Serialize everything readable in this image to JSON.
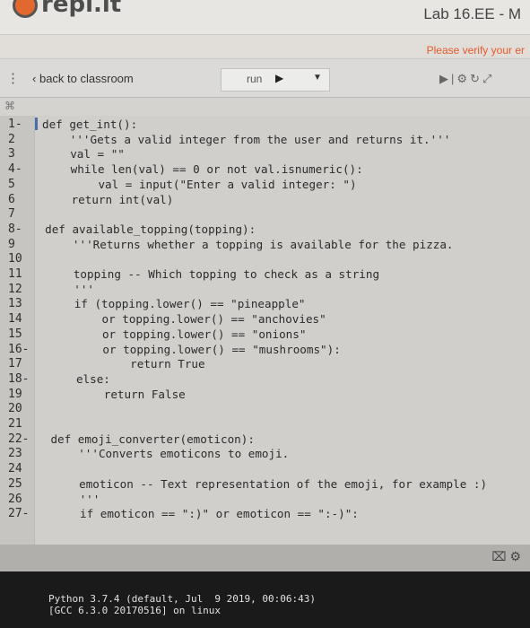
{
  "header": {
    "logo_text": "repl.it",
    "lab_title": "Lab 16.EE - M",
    "verify_notice": "Please verify your er"
  },
  "toolbar": {
    "menu_icon": "vertical-dots-icon",
    "back_label": "back to classroom",
    "run_label": "run",
    "run_icon": "play-icon",
    "dropdown_icon": "caret-down-icon",
    "right_icons": [
      "step-icon",
      "settings-icon",
      "reload-icon",
      "expand-icon"
    ]
  },
  "file_icon": "file-icon",
  "editor": {
    "lines": [
      {
        "n": "1",
        "fold": true,
        "text": "def get_int():"
      },
      {
        "n": "2",
        "fold": false,
        "text": "    '''Gets a valid integer from the user and returns it.'''"
      },
      {
        "n": "3",
        "fold": false,
        "text": "    val = \"\""
      },
      {
        "n": "4",
        "fold": true,
        "text": "    while len(val) == 0 or not val.isnumeric():"
      },
      {
        "n": "5",
        "fold": false,
        "text": "        val = input(\"Enter a valid integer: \")"
      },
      {
        "n": "6",
        "fold": false,
        "text": "    return int(val)"
      },
      {
        "n": "7",
        "fold": false,
        "text": ""
      },
      {
        "n": "8",
        "fold": true,
        "text": "def available_topping(topping):"
      },
      {
        "n": "9",
        "fold": false,
        "text": "    '''Returns whether a topping is available for the pizza."
      },
      {
        "n": "10",
        "fold": false,
        "text": ""
      },
      {
        "n": "11",
        "fold": false,
        "text": "    topping -- Which topping to check as a string"
      },
      {
        "n": "12",
        "fold": false,
        "text": "    '''"
      },
      {
        "n": "13",
        "fold": false,
        "text": "    if (topping.lower() == \"pineapple\""
      },
      {
        "n": "14",
        "fold": false,
        "text": "        or topping.lower() == \"anchovies\""
      },
      {
        "n": "15",
        "fold": false,
        "text": "        or topping.lower() == \"onions\""
      },
      {
        "n": "16",
        "fold": true,
        "text": "        or topping.lower() == \"mushrooms\"):"
      },
      {
        "n": "17",
        "fold": false,
        "text": "            return True"
      },
      {
        "n": "18",
        "fold": true,
        "text": "    else:"
      },
      {
        "n": "19",
        "fold": false,
        "text": "        return False"
      },
      {
        "n": "20",
        "fold": false,
        "text": ""
      },
      {
        "n": "21",
        "fold": false,
        "text": ""
      },
      {
        "n": "22",
        "fold": true,
        "text": "def emoji_converter(emoticon):"
      },
      {
        "n": "23",
        "fold": false,
        "text": "    '''Converts emoticons to emoji."
      },
      {
        "n": "24",
        "fold": false,
        "text": ""
      },
      {
        "n": "25",
        "fold": false,
        "text": "    emoticon -- Text representation of the emoji, for example :)"
      },
      {
        "n": "26",
        "fold": false,
        "text": "    '''"
      },
      {
        "n": "27",
        "fold": true,
        "text": "    if emoticon == \":)\" or emoticon == \":-)\":"
      }
    ]
  },
  "console": {
    "icons": [
      "clear-icon",
      "settings-icon"
    ],
    "lines": [
      "Python 3.7.4 (default, Jul  9 2019, 00:06:43)",
      "[GCC 6.3.0 20170516] on linux"
    ]
  }
}
